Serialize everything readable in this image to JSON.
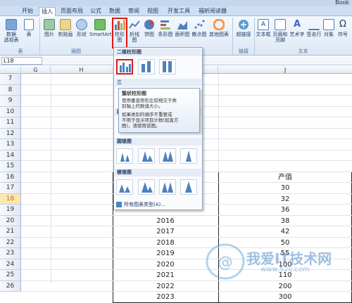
{
  "window": {
    "title_fragment": "Book"
  },
  "tabs": [
    {
      "label": "开始",
      "active": false
    },
    {
      "label": "插入",
      "active": true
    },
    {
      "label": "页面布局",
      "active": false
    },
    {
      "label": "公式",
      "active": false
    },
    {
      "label": "数据",
      "active": false
    },
    {
      "label": "审阅",
      "active": false
    },
    {
      "label": "视图",
      "active": false
    },
    {
      "label": "开发工具",
      "active": false
    },
    {
      "label": "福昕阅读器",
      "active": false
    }
  ],
  "ribbon": {
    "pivot_label_1": "数据",
    "pivot_label_2": "透视表",
    "table": "表",
    "picture": "图片",
    "clipart": "剪贴画",
    "shapes": "形状",
    "smartart": "SmartArt",
    "column": "柱形图",
    "line": "折线图",
    "pie": "饼图",
    "bar": "条形图",
    "area": "面积图",
    "scatter": "散点图",
    "other": "其他图表",
    "hyperlink": "超链接",
    "textbox": "文本框",
    "header_1": "页眉和",
    "header_2": "页脚",
    "wordart": "艺术字",
    "signature": "签名行",
    "object": "对象",
    "symbol": "符号",
    "groups": {
      "table": "表",
      "illustrations": "插图",
      "links": "链接",
      "text": "文本"
    }
  },
  "namebox": "L18",
  "columns": {
    "g": "G",
    "h": "H",
    "j": "J"
  },
  "rows": [
    "7",
    "8",
    "9",
    "10",
    "11",
    "12",
    "13",
    "14",
    "15",
    "16",
    "17",
    "18",
    "19",
    "20",
    "21",
    "22",
    "23",
    "24",
    "25",
    "26"
  ],
  "highlighted_row": "18",
  "table": {
    "header": "产值",
    "years": [
      "",
      "",
      "",
      "2016",
      "2017",
      "2018",
      "2019",
      "2020",
      "2021",
      "2022",
      "2023"
    ],
    "values": [
      "30",
      "32",
      "36",
      "38",
      "42",
      "50",
      "55",
      "100",
      "110",
      "200",
      "300"
    ]
  },
  "dropdown": {
    "section_2d": "二维柱形图",
    "section_3d": "三",
    "section_cyl": "圆",
    "section_cone": "圆锥图",
    "section_pyr": "棱锥图",
    "all_types": "所有图表类型(A)..."
  },
  "tooltip": {
    "title": "簇状柱形图",
    "line1": "使用垂直矩形比较相交于类",
    "line2": "别轴上的数值大小。",
    "line3": "如果类别的顺序不重要或",
    "line4": "不用于显示项目计数(如直方",
    "line5": "图)，请使用该图。"
  },
  "watermark": {
    "text": "我爱IT技术网",
    "url": "www.52ij.com"
  },
  "colors": {
    "accent": "#e01818",
    "ribbon": "#dde8f6",
    "highlight_row": "#fde7b0"
  }
}
